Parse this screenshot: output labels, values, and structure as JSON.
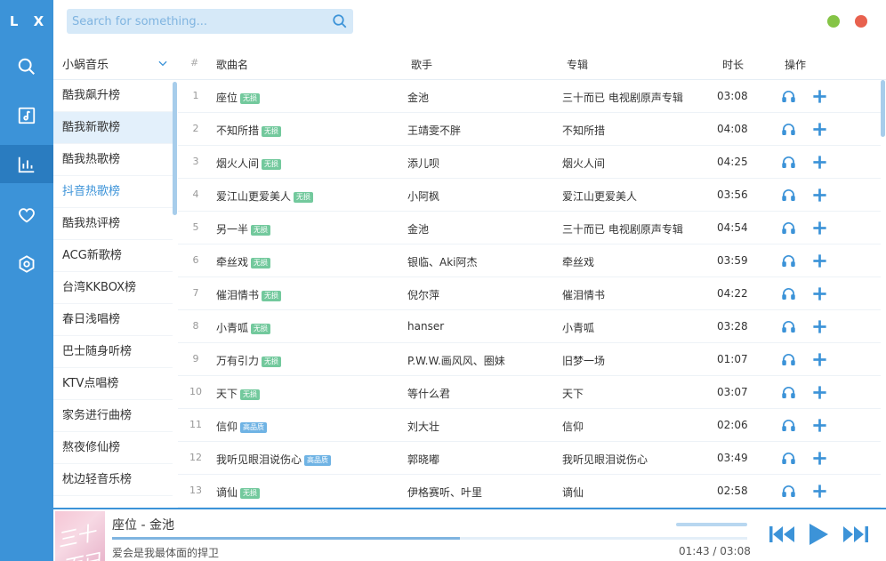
{
  "app": {
    "logo": "L X"
  },
  "colors": {
    "accent": "#3c93d8",
    "accent_dark": "#2a7cc0",
    "free_badge": "#73c99d",
    "hq_badge": "#6fb3e4",
    "window_min": "#85c446",
    "window_close": "#e8614e"
  },
  "rail": {
    "icons": [
      "search-icon",
      "music-library-icon",
      "chart-icon",
      "heart-icon",
      "settings-icon"
    ],
    "active": "chart-icon"
  },
  "search": {
    "placeholder": "Search for something..."
  },
  "sidebar": {
    "source": "小蜗音乐",
    "boards": [
      "酷我飙升榜",
      "酷我新歌榜",
      "酷我热歌榜",
      "抖音热歌榜",
      "酷我热评榜",
      "ACG新歌榜",
      "台湾KKBOX榜",
      "春日浅唱榜",
      "巴士随身听榜",
      "KTV点唱榜",
      "家务进行曲榜",
      "熬夜修仙榜",
      "枕边轻音乐榜"
    ],
    "active_index": 1,
    "hover_index": 3
  },
  "table": {
    "headers": {
      "num": "#",
      "name": "歌曲名",
      "singer": "歌手",
      "album": "专辑",
      "duration": "时长",
      "ops": "操作"
    },
    "rows": [
      {
        "num": "1",
        "name": "座位",
        "badge": "无损",
        "singer": "金池",
        "album": "三十而已 电视剧原声专辑",
        "duration": "03:08"
      },
      {
        "num": "2",
        "name": "不知所措",
        "badge": "无损",
        "singer": "王靖雯不胖",
        "album": "不知所措",
        "duration": "04:08"
      },
      {
        "num": "3",
        "name": "烟火人间",
        "badge": "无损",
        "singer": "添儿呗",
        "album": "烟火人间",
        "duration": "04:25"
      },
      {
        "num": "4",
        "name": "爱江山更爱美人",
        "badge": "无损",
        "singer": "小阿枫",
        "album": "爱江山更爱美人",
        "duration": "03:56"
      },
      {
        "num": "5",
        "name": "另一半",
        "badge": "无损",
        "singer": "金池",
        "album": "三十而已 电视剧原声专辑",
        "duration": "04:54"
      },
      {
        "num": "6",
        "name": "牵丝戏",
        "badge": "无损",
        "singer": "银临、Aki阿杰",
        "album": "牵丝戏",
        "duration": "03:59"
      },
      {
        "num": "7",
        "name": "催泪情书",
        "badge": "无损",
        "singer": "倪尔萍",
        "album": "催泪情书",
        "duration": "04:22"
      },
      {
        "num": "8",
        "name": "小青呱",
        "badge": "无损",
        "singer": "hanser",
        "album": "小青呱",
        "duration": "03:28"
      },
      {
        "num": "9",
        "name": "万有引力",
        "badge": "无损",
        "singer": "P.W.W.画风风、圈妹",
        "album": "旧梦一场",
        "duration": "01:07"
      },
      {
        "num": "10",
        "name": "天下",
        "badge": "无损",
        "singer": "等什么君",
        "album": "天下",
        "duration": "03:07"
      },
      {
        "num": "11",
        "name": "信仰",
        "badge": "高品质",
        "singer": "刘大壮",
        "album": "信仰",
        "duration": "02:06"
      },
      {
        "num": "12",
        "name": "我听见眼泪说伤心",
        "badge": "高品质",
        "singer": "郭晓嘟",
        "album": "我听见眼泪说伤心",
        "duration": "03:49"
      },
      {
        "num": "13",
        "name": "谪仙",
        "badge": "无损",
        "singer": "伊格赛听、叶里",
        "album": "谪仙",
        "duration": "02:58"
      }
    ]
  },
  "player": {
    "cover_text": "三十而已",
    "title": "座位 - 金池",
    "lyric": "爱会是我最体面的捍卫",
    "time": "01:43 / 03:08",
    "progress": 0.548
  }
}
